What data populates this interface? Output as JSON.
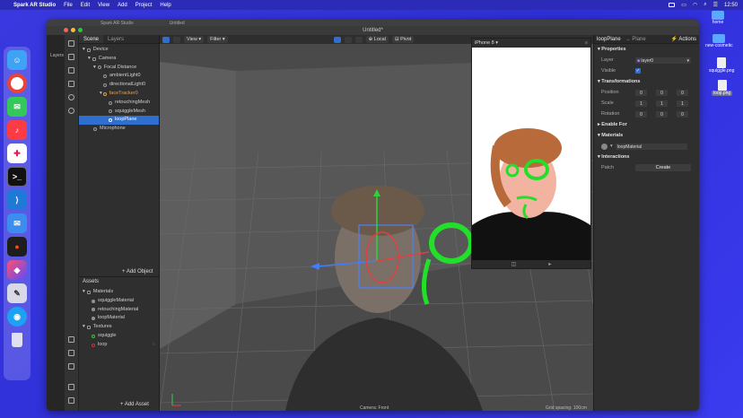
{
  "menubar": {
    "app": "Spark AR Studio",
    "items": [
      "File",
      "Edit",
      "View",
      "Add",
      "Project",
      "Help"
    ],
    "time": "12:50"
  },
  "desktop": [
    {
      "label": "home",
      "kind": "folder"
    },
    {
      "label": "new-cosmetic",
      "kind": "folder"
    },
    {
      "label": "squiggle.png",
      "kind": "file"
    },
    {
      "label": "loop.png",
      "kind": "file"
    }
  ],
  "window": {
    "title": "Untitled*",
    "bg_tab_1": "Spark AR Studio",
    "bg_tab_2": "Untitled"
  },
  "strip": {
    "label": "Layers"
  },
  "scene": {
    "tabs": [
      "Scene",
      "Layers"
    ],
    "tree": [
      {
        "label": "Device",
        "indent": 0,
        "icon": "device"
      },
      {
        "label": "Camera",
        "indent": 1,
        "icon": "camera"
      },
      {
        "label": "Focal Distance",
        "indent": 2,
        "icon": "focal"
      },
      {
        "label": "ambientLight0",
        "indent": 3,
        "icon": "light"
      },
      {
        "label": "directionalLight0",
        "indent": 3,
        "icon": "light"
      },
      {
        "label": "faceTracker0",
        "indent": 3,
        "icon": "face"
      },
      {
        "label": "retouchingMesh",
        "indent": 4,
        "icon": "mesh"
      },
      {
        "label": "squiggleMesh",
        "indent": 4,
        "icon": "mesh"
      },
      {
        "label": "loopPlane",
        "indent": 4,
        "icon": "plane"
      },
      {
        "label": "Microphone",
        "indent": 1,
        "icon": "mic"
      }
    ],
    "add_object": "+ Add Object",
    "assets_title": "Assets",
    "assets": [
      {
        "label": "Materials",
        "indent": 0
      },
      {
        "label": "squiggleMaterial",
        "indent": 1
      },
      {
        "label": "retouchingMaterial",
        "indent": 1
      },
      {
        "label": "loopMaterial",
        "indent": 1
      },
      {
        "label": "Textures",
        "indent": 0
      },
      {
        "label": "squiggle",
        "indent": 1
      },
      {
        "label": "loop",
        "indent": 1
      }
    ],
    "add_asset": "+ Add Asset"
  },
  "viewport": {
    "view_label": "View",
    "filter_label": "Filter",
    "local_label": "Local",
    "pivot_label": "Pivot",
    "camera_caption": "Camera: Front",
    "grid_caption": "Grid spacing: 100cm"
  },
  "simulator": {
    "device": "iPhone 8"
  },
  "inspector": {
    "object": "loopPlane",
    "type": "Plane",
    "actions": "Actions",
    "properties_title": "Properties",
    "layer_label": "Layer",
    "layer_value": "layer0",
    "visible_label": "Visible",
    "transformations_title": "Transformations",
    "position_label": "Position",
    "position": [
      "0",
      "0",
      "0"
    ],
    "scale_label": "Scale",
    "scale": [
      "1",
      "1",
      "1"
    ],
    "rotation_label": "Rotation",
    "rotation": [
      "0",
      "0",
      "0"
    ],
    "enable_for_title": "Enable For",
    "materials_title": "Materials",
    "material_value": "loopMaterial",
    "interactions_title": "Interactions",
    "patch_label": "Patch",
    "create_label": "Create"
  }
}
